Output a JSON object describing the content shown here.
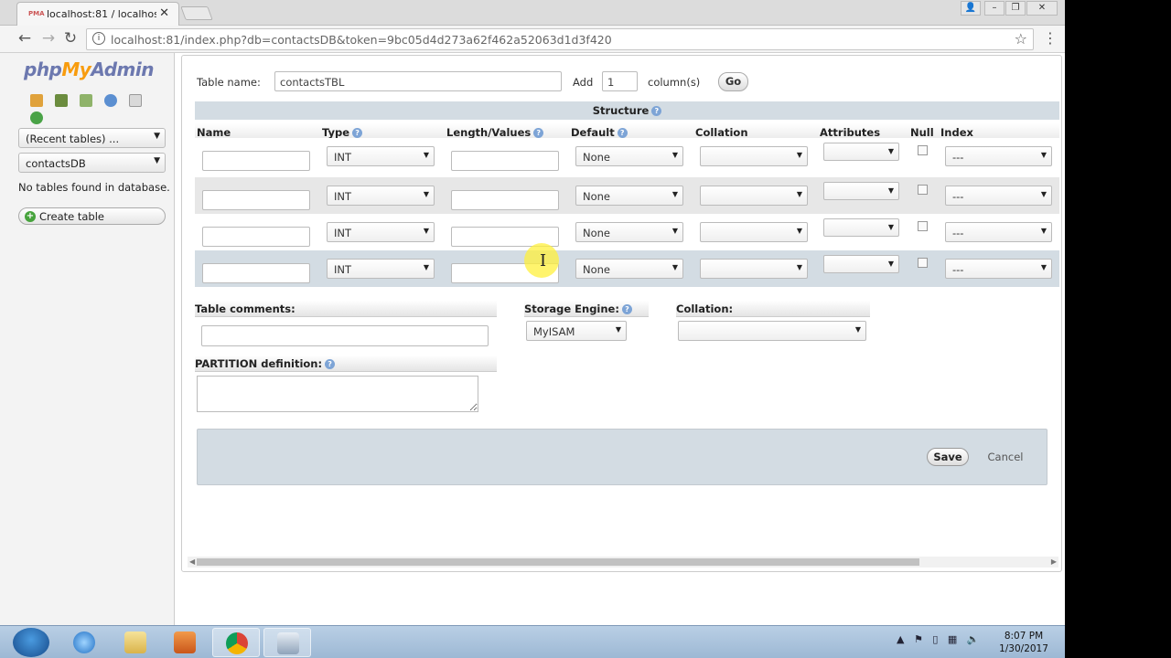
{
  "browser": {
    "tab_title": "localhost:81 / localhost /",
    "tab_favicon": "PMA",
    "url": "localhost:81/index.php?db=contactsDB&token=9bc05d4d273a62f462a52063d1d3f420"
  },
  "nav": {
    "logo_php": "php",
    "logo_my": "My",
    "logo_admin": "Admin",
    "recent_tables": "(Recent tables) ...",
    "database": "contactsDB",
    "no_tables": "No tables found in database.",
    "create_table": "Create table"
  },
  "form": {
    "table_name_label": "Table name:",
    "table_name_value": "contactsTBL",
    "add_label": "Add",
    "add_count": "1",
    "columns_label": "column(s)",
    "go_label": "Go",
    "structure_label": "Structure",
    "headers": {
      "name": "Name",
      "type": "Type",
      "length": "Length/Values",
      "default": "Default",
      "collation": "Collation",
      "attributes": "Attributes",
      "null": "Null",
      "index": "Index"
    },
    "rows": [
      {
        "type": "INT",
        "default": "None",
        "index": "---"
      },
      {
        "type": "INT",
        "default": "None",
        "index": "---"
      },
      {
        "type": "INT",
        "default": "None",
        "index": "---"
      },
      {
        "type": "INT",
        "default": "None",
        "index": "---"
      }
    ],
    "table_comments_label": "Table comments:",
    "storage_engine_label": "Storage Engine:",
    "storage_engine_value": "MyISAM",
    "collation_label": "Collation:",
    "partition_label": "PARTITION definition:",
    "save_label": "Save",
    "cancel_label": "Cancel"
  },
  "taskbar": {
    "time": "8:07 PM",
    "date": "1/30/2017"
  },
  "colors": {
    "structure_bar": "#d3dce3",
    "highlight_row": "#d3dce3",
    "logo_blue": "#6c78af",
    "logo_orange": "#f89c0e"
  }
}
